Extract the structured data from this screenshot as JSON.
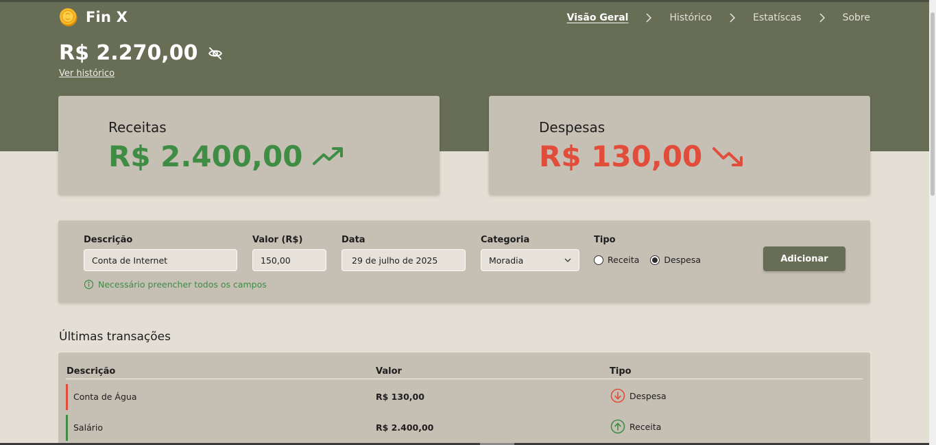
{
  "app": {
    "name": "Fin X",
    "brand_icon": "coin-icon"
  },
  "nav": {
    "items": [
      {
        "label": "Visão Geral",
        "active": true
      },
      {
        "label": "Histórico",
        "active": false
      },
      {
        "label": "Estatíscas",
        "active": false
      },
      {
        "label": "Sobre",
        "active": false
      }
    ]
  },
  "balance": {
    "value": "R$ 2.270,00",
    "visibility_icon": "eye-off-icon",
    "history_link": "Ver histórico"
  },
  "summary": {
    "income": {
      "title": "Receitas",
      "amount": "R$ 2.400,00",
      "icon": "trending-up-icon",
      "color": "#3f8d45"
    },
    "expense": {
      "title": "Despesas",
      "amount": "R$ 130,00",
      "icon": "trending-down-icon",
      "color": "#e24d3b"
    }
  },
  "form": {
    "description": {
      "label": "Descrição",
      "value": "Conta de Internet"
    },
    "amount": {
      "label": "Valor (R$)",
      "value": "150,00"
    },
    "date": {
      "label": "Data",
      "value": "29 de julho de 2025"
    },
    "category": {
      "label": "Categoria",
      "value": "Moradia"
    },
    "type": {
      "label": "Tipo",
      "options": [
        {
          "label": "Receita",
          "checked": false
        },
        {
          "label": "Despesa",
          "checked": true
        }
      ]
    },
    "submit_label": "Adicionar",
    "hint": "Necessário preencher todos os campos"
  },
  "transactions": {
    "title": "Últimas transações",
    "columns": [
      "Descrição",
      "Valor",
      "Tipo"
    ],
    "rows": [
      {
        "description": "Conta de Água",
        "value": "R$ 130,00",
        "type": "Despesa",
        "color": "#e24d3b",
        "icon": "arrow-down-circle-icon"
      },
      {
        "description": "Salário",
        "value": "R$ 2.400,00",
        "type": "Receita",
        "color": "#3f8d45",
        "icon": "arrow-up-circle-icon"
      }
    ]
  },
  "colors": {
    "header_bg": "#676e55",
    "page_bg": "#e3dfd4",
    "panel_bg": "#c5bfb4",
    "income": "#3f8d45",
    "expense": "#e24d3b"
  }
}
